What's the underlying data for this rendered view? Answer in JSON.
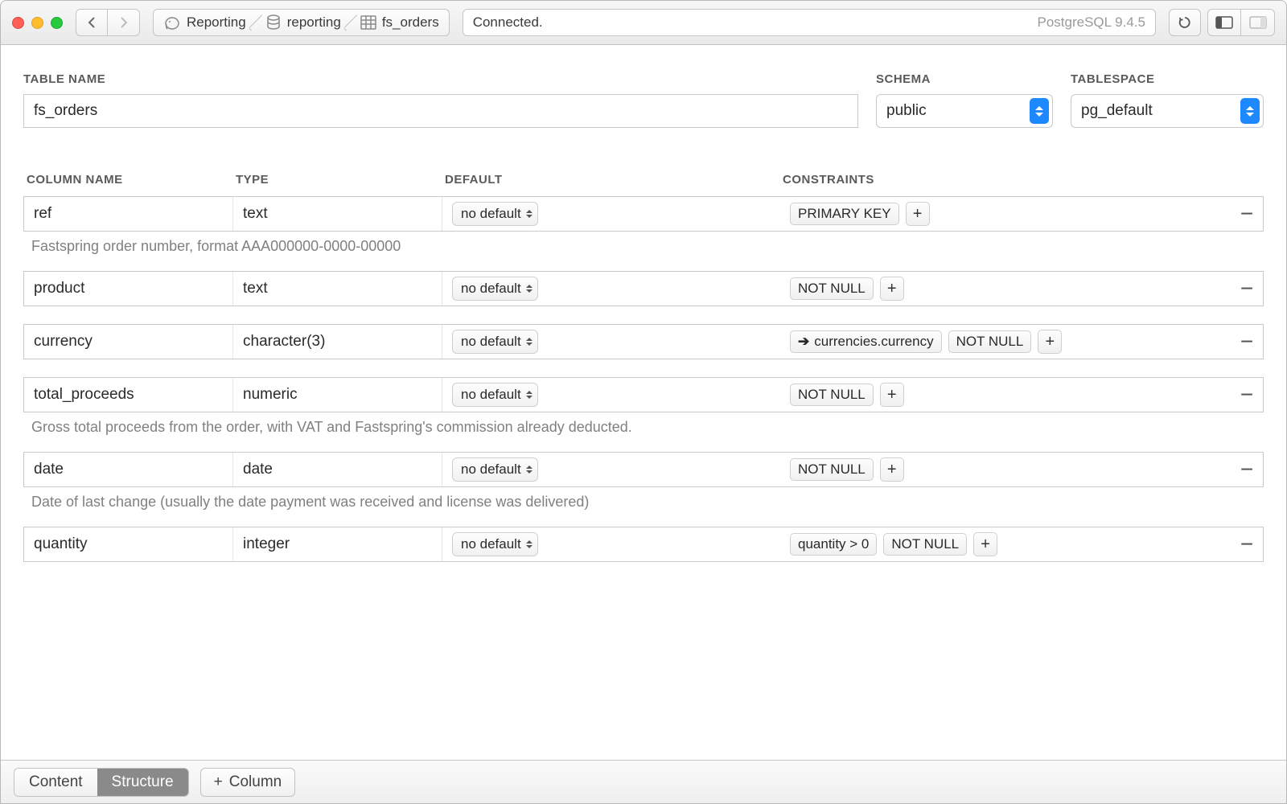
{
  "titlebar": {
    "breadcrumb": [
      {
        "icon": "elephant-icon",
        "label": "Reporting"
      },
      {
        "icon": "database-icon",
        "label": "reporting"
      },
      {
        "icon": "table-icon",
        "label": "fs_orders"
      }
    ],
    "status_text": "Connected.",
    "db_version": "PostgreSQL 9.4.5"
  },
  "form": {
    "labels": {
      "table_name": "TABLE NAME",
      "schema": "SCHEMA",
      "tablespace": "TABLESPACE",
      "column_name": "COLUMN NAME",
      "type": "TYPE",
      "default": "DEFAULT",
      "constraints": "CONSTRAINTS"
    },
    "table_name_value": "fs_orders",
    "schema_value": "public",
    "tablespace_value": "pg_default",
    "default_placeholder": "no default"
  },
  "columns": [
    {
      "name": "ref",
      "type": "text",
      "constraints": [
        {
          "kind": "text",
          "text": "PRIMARY KEY"
        }
      ],
      "description": "Fastspring order number, format AAA000000-0000-00000"
    },
    {
      "name": "product",
      "type": "text",
      "constraints": [
        {
          "kind": "text",
          "text": "NOT NULL"
        }
      ],
      "description": ""
    },
    {
      "name": "currency",
      "type": "character(3)",
      "constraints": [
        {
          "kind": "fk",
          "text": "currencies.currency"
        },
        {
          "kind": "text",
          "text": "NOT NULL"
        }
      ],
      "description": ""
    },
    {
      "name": "total_proceeds",
      "type": "numeric",
      "constraints": [
        {
          "kind": "text",
          "text": "NOT NULL"
        }
      ],
      "description": "Gross total proceeds from the order, with VAT and Fastspring's commission already deducted."
    },
    {
      "name": "date",
      "type": "date",
      "constraints": [
        {
          "kind": "text",
          "text": "NOT NULL"
        }
      ],
      "description": "Date of last change (usually the date payment was received and license was delivered)"
    },
    {
      "name": "quantity",
      "type": "integer",
      "constraints": [
        {
          "kind": "text",
          "text": "quantity > 0"
        },
        {
          "kind": "text",
          "text": "NOT NULL"
        }
      ],
      "description": ""
    }
  ],
  "footer": {
    "tab_content": "Content",
    "tab_structure": "Structure",
    "add_column": "Column",
    "plus": "+"
  }
}
